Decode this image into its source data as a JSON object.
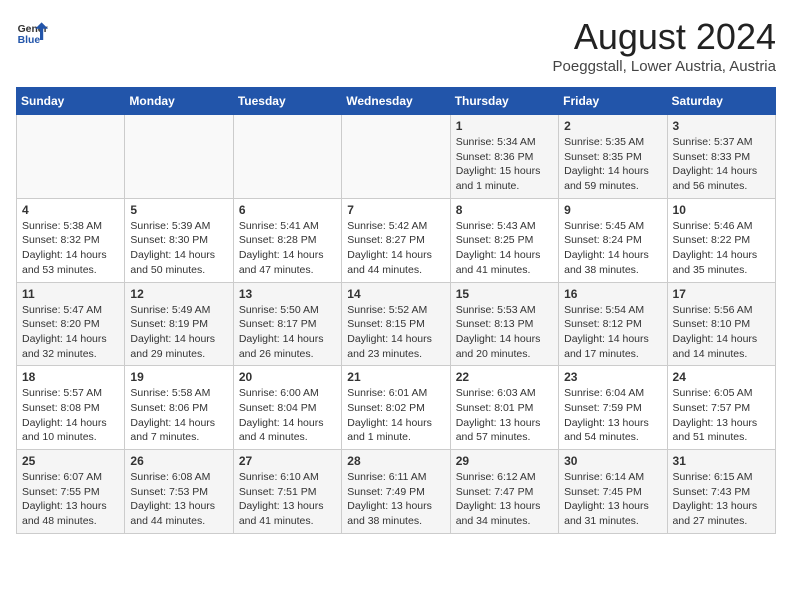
{
  "header": {
    "logo_general": "General",
    "logo_blue": "Blue",
    "title": "August 2024",
    "subtitle": "Poeggstall, Lower Austria, Austria"
  },
  "days_of_week": [
    "Sunday",
    "Monday",
    "Tuesday",
    "Wednesday",
    "Thursday",
    "Friday",
    "Saturday"
  ],
  "weeks": [
    [
      {
        "day": "",
        "info": ""
      },
      {
        "day": "",
        "info": ""
      },
      {
        "day": "",
        "info": ""
      },
      {
        "day": "",
        "info": ""
      },
      {
        "day": "1",
        "info": "Sunrise: 5:34 AM\nSunset: 8:36 PM\nDaylight: 15 hours\nand 1 minute."
      },
      {
        "day": "2",
        "info": "Sunrise: 5:35 AM\nSunset: 8:35 PM\nDaylight: 14 hours\nand 59 minutes."
      },
      {
        "day": "3",
        "info": "Sunrise: 5:37 AM\nSunset: 8:33 PM\nDaylight: 14 hours\nand 56 minutes."
      }
    ],
    [
      {
        "day": "4",
        "info": "Sunrise: 5:38 AM\nSunset: 8:32 PM\nDaylight: 14 hours\nand 53 minutes."
      },
      {
        "day": "5",
        "info": "Sunrise: 5:39 AM\nSunset: 8:30 PM\nDaylight: 14 hours\nand 50 minutes."
      },
      {
        "day": "6",
        "info": "Sunrise: 5:41 AM\nSunset: 8:28 PM\nDaylight: 14 hours\nand 47 minutes."
      },
      {
        "day": "7",
        "info": "Sunrise: 5:42 AM\nSunset: 8:27 PM\nDaylight: 14 hours\nand 44 minutes."
      },
      {
        "day": "8",
        "info": "Sunrise: 5:43 AM\nSunset: 8:25 PM\nDaylight: 14 hours\nand 41 minutes."
      },
      {
        "day": "9",
        "info": "Sunrise: 5:45 AM\nSunset: 8:24 PM\nDaylight: 14 hours\nand 38 minutes."
      },
      {
        "day": "10",
        "info": "Sunrise: 5:46 AM\nSunset: 8:22 PM\nDaylight: 14 hours\nand 35 minutes."
      }
    ],
    [
      {
        "day": "11",
        "info": "Sunrise: 5:47 AM\nSunset: 8:20 PM\nDaylight: 14 hours\nand 32 minutes."
      },
      {
        "day": "12",
        "info": "Sunrise: 5:49 AM\nSunset: 8:19 PM\nDaylight: 14 hours\nand 29 minutes."
      },
      {
        "day": "13",
        "info": "Sunrise: 5:50 AM\nSunset: 8:17 PM\nDaylight: 14 hours\nand 26 minutes."
      },
      {
        "day": "14",
        "info": "Sunrise: 5:52 AM\nSunset: 8:15 PM\nDaylight: 14 hours\nand 23 minutes."
      },
      {
        "day": "15",
        "info": "Sunrise: 5:53 AM\nSunset: 8:13 PM\nDaylight: 14 hours\nand 20 minutes."
      },
      {
        "day": "16",
        "info": "Sunrise: 5:54 AM\nSunset: 8:12 PM\nDaylight: 14 hours\nand 17 minutes."
      },
      {
        "day": "17",
        "info": "Sunrise: 5:56 AM\nSunset: 8:10 PM\nDaylight: 14 hours\nand 14 minutes."
      }
    ],
    [
      {
        "day": "18",
        "info": "Sunrise: 5:57 AM\nSunset: 8:08 PM\nDaylight: 14 hours\nand 10 minutes."
      },
      {
        "day": "19",
        "info": "Sunrise: 5:58 AM\nSunset: 8:06 PM\nDaylight: 14 hours\nand 7 minutes."
      },
      {
        "day": "20",
        "info": "Sunrise: 6:00 AM\nSunset: 8:04 PM\nDaylight: 14 hours\nand 4 minutes."
      },
      {
        "day": "21",
        "info": "Sunrise: 6:01 AM\nSunset: 8:02 PM\nDaylight: 14 hours\nand 1 minute."
      },
      {
        "day": "22",
        "info": "Sunrise: 6:03 AM\nSunset: 8:01 PM\nDaylight: 13 hours\nand 57 minutes."
      },
      {
        "day": "23",
        "info": "Sunrise: 6:04 AM\nSunset: 7:59 PM\nDaylight: 13 hours\nand 54 minutes."
      },
      {
        "day": "24",
        "info": "Sunrise: 6:05 AM\nSunset: 7:57 PM\nDaylight: 13 hours\nand 51 minutes."
      }
    ],
    [
      {
        "day": "25",
        "info": "Sunrise: 6:07 AM\nSunset: 7:55 PM\nDaylight: 13 hours\nand 48 minutes."
      },
      {
        "day": "26",
        "info": "Sunrise: 6:08 AM\nSunset: 7:53 PM\nDaylight: 13 hours\nand 44 minutes."
      },
      {
        "day": "27",
        "info": "Sunrise: 6:10 AM\nSunset: 7:51 PM\nDaylight: 13 hours\nand 41 minutes."
      },
      {
        "day": "28",
        "info": "Sunrise: 6:11 AM\nSunset: 7:49 PM\nDaylight: 13 hours\nand 38 minutes."
      },
      {
        "day": "29",
        "info": "Sunrise: 6:12 AM\nSunset: 7:47 PM\nDaylight: 13 hours\nand 34 minutes."
      },
      {
        "day": "30",
        "info": "Sunrise: 6:14 AM\nSunset: 7:45 PM\nDaylight: 13 hours\nand 31 minutes."
      },
      {
        "day": "31",
        "info": "Sunrise: 6:15 AM\nSunset: 7:43 PM\nDaylight: 13 hours\nand 27 minutes."
      }
    ]
  ]
}
